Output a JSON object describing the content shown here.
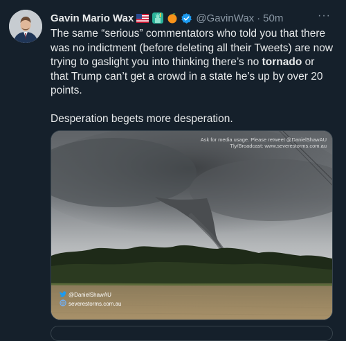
{
  "author": {
    "name": "Gavin Mario Wax",
    "handle": "@GavinWax",
    "time": "50m",
    "separator": "·"
  },
  "menu": {
    "label": "···"
  },
  "tweet": {
    "line1_before": "The same “serious” commentators who told you that there was no indictment (before deleting all their Tweets) are now trying to gaslight you into thinking there’s no ",
    "bold_word": "tornado",
    "line1_after": " or that Trump can’t get a crowd in a state he’s up by over 20 points.",
    "line2": "Desperation begets more desperation."
  },
  "media": {
    "watermark_line1": "Ask for media usage. Please retweet @DanielShawAU",
    "watermark_line2": "Tly/Broadcast: www.severestorms.com.au",
    "credit_twitter": "@DanielShawAU",
    "credit_site": "severestorms.com.au"
  },
  "colors": {
    "background": "#15202b",
    "verified_blue": "#1d9bf0",
    "muted_text": "#8b98a5"
  },
  "icons": [
    "us-flag-icon",
    "statue-of-liberty-icon",
    "orange-icon",
    "verified-badge-icon",
    "twitter-bird-icon",
    "globe-icon"
  ]
}
